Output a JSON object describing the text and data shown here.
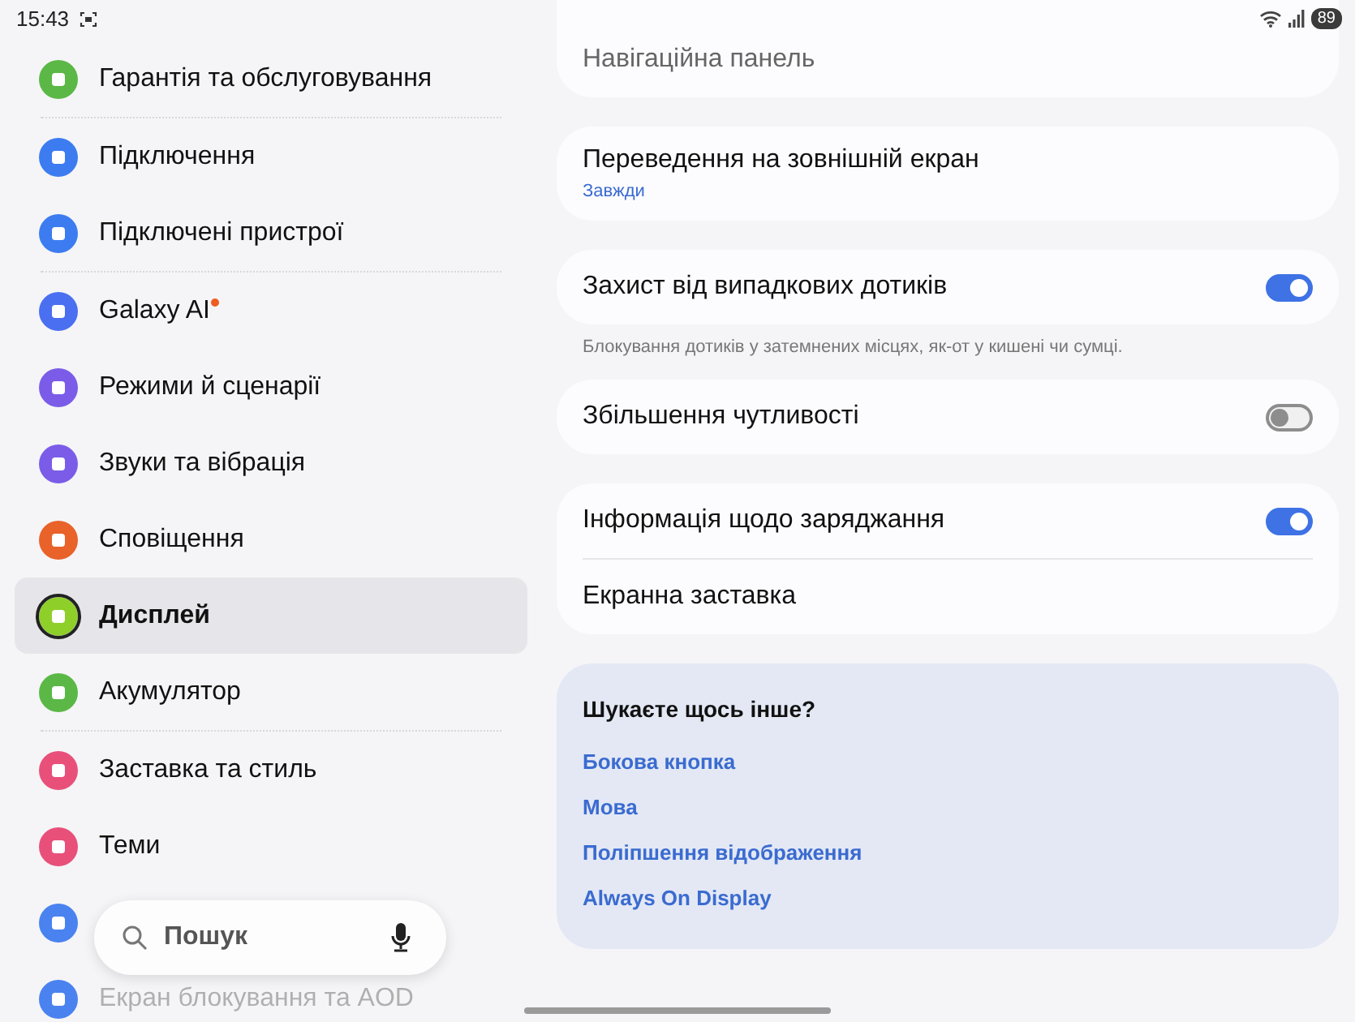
{
  "status_bar": {
    "time": "15:43",
    "battery": "89"
  },
  "sidebar": {
    "groups": [
      [
        {
          "label": "Гарантія та обслуговування",
          "color": "#5bb846",
          "selected": false,
          "badge": false,
          "faded": false
        }
      ],
      [
        {
          "label": "Підключення",
          "color": "#3c7cf0",
          "selected": false,
          "badge": false,
          "faded": false
        },
        {
          "label": "Підключені пристрої",
          "color": "#3c7cf0",
          "selected": false,
          "badge": false,
          "faded": false
        }
      ],
      [
        {
          "label": "Galaxy AI",
          "color": "#4a6ff0",
          "selected": false,
          "badge": true,
          "faded": false
        },
        {
          "label": "Режими й сценарії",
          "color": "#7b5ce8",
          "selected": false,
          "badge": false,
          "faded": false
        },
        {
          "label": "Звуки та вібрація",
          "color": "#7b5ce8",
          "selected": false,
          "badge": false,
          "faded": false
        },
        {
          "label": "Сповіщення",
          "color": "#e8622a",
          "selected": false,
          "badge": false,
          "faded": false
        },
        {
          "label": "Дисплей",
          "color": "#8fcf2a",
          "selected": true,
          "badge": false,
          "faded": false
        },
        {
          "label": "Акумулятор",
          "color": "#5bb846",
          "selected": false,
          "badge": false,
          "faded": false
        }
      ],
      [
        {
          "label": "Заставка та стиль",
          "color": "#e8507a",
          "selected": false,
          "badge": false,
          "faded": false
        },
        {
          "label": "Теми",
          "color": "#e8507a",
          "selected": false,
          "badge": false,
          "faded": false
        },
        {
          "color": "#4a82f0",
          "selected": false
        },
        {
          "label": "Екран блокування та AOD",
          "color": "#4a82f0",
          "selected": false,
          "badge": false,
          "faded": true
        }
      ]
    ]
  },
  "search": {
    "placeholder": "Пошук"
  },
  "cards": [
    {
      "rows": [
        {
          "kind": "plain",
          "title": "Навігаційна панель",
          "faded": true
        }
      ]
    },
    {
      "rows": [
        {
          "kind": "plain",
          "title": "Переведення на зовнішній екран",
          "subtitle": "Завжди",
          "faded": false
        }
      ]
    },
    {
      "rows": [
        {
          "kind": "toggle",
          "title": "Захист від випадкових дотиків",
          "on": true,
          "faded": false
        }
      ],
      "note": "Блокування дотиків у затемнених місцях, як-от у кишені чи сумці."
    },
    {
      "rows": [
        {
          "kind": "toggle",
          "title": "Збільшення чутливості",
          "on": false,
          "faded": false
        }
      ]
    },
    {
      "rows": [
        {
          "kind": "toggle",
          "title": "Інформація щодо заряджання",
          "on": true,
          "faded": false
        },
        {
          "kind": "plain",
          "title": "Екранна заставка",
          "faded": false
        }
      ]
    }
  ],
  "related": {
    "title": "Шукаєте щось інше?",
    "links": [
      "Бокова кнопка",
      "Мова",
      "Поліпшення відображення",
      "Always On Display"
    ]
  }
}
